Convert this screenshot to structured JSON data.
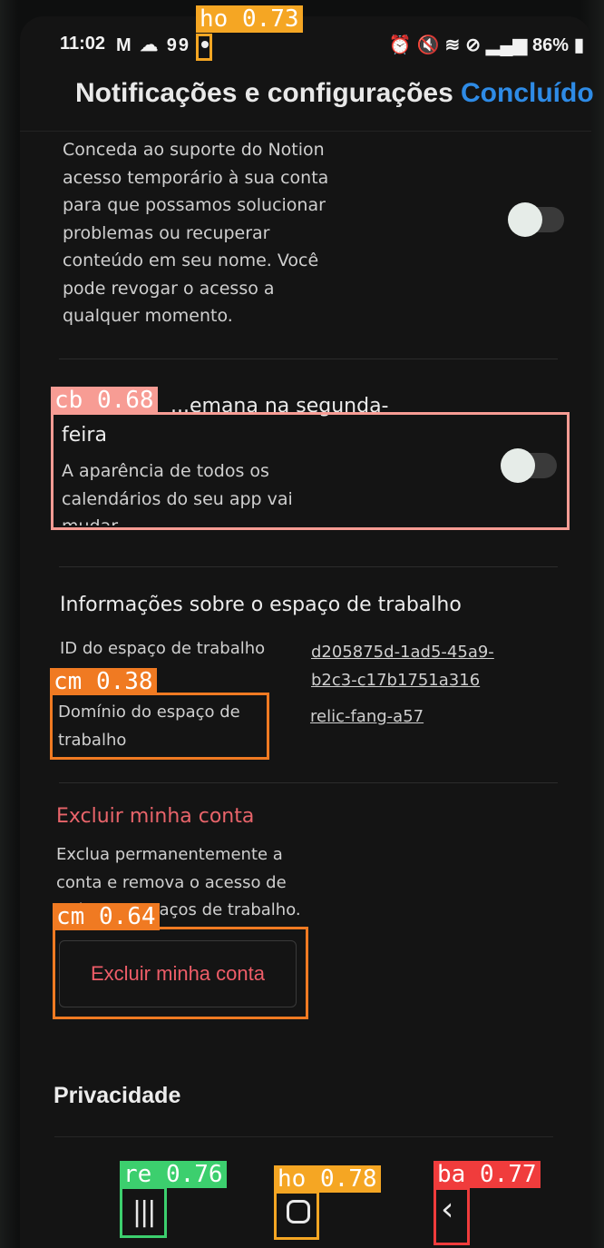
{
  "status_bar": {
    "time": "11:02",
    "left_icons": "M ☁ 99",
    "battery": "86%"
  },
  "header": {
    "title": "Notificações e configurações",
    "done_label": "Concluído"
  },
  "support_access": {
    "description_lines": [
      "Conceda ao suporte do Notion",
      "acesso temporário à sua conta",
      "para que possamos solucionar",
      "problemas ou recuperar",
      "conteúdo em seu nome. Você",
      "pode revogar o acesso a",
      "qualquer momento."
    ],
    "toggle_on": false
  },
  "week_start": {
    "title_line1": "...emana na segunda-",
    "title_line2": "feira",
    "description_lines": [
      "A aparência de todos os",
      "calendários do seu app vai",
      "mudar"
    ],
    "toggle_on": false
  },
  "workspace_info": {
    "title": "Informações sobre o espaço de trabalho",
    "id_label": "ID do espaço de trabalho",
    "id_value_line1": "d205875d-1ad5-45a9-",
    "id_value_line2": "b2c3-c17b1751a316",
    "domain_label_line1": "Domínio do espaço de",
    "domain_label_line2": "trabalho",
    "domain_value": "relic-fang-a57"
  },
  "delete_account": {
    "title": "Excluir minha conta",
    "description_lines": [
      "Exclua permanentemente a",
      "conta e remova o acesso de",
      "todos os espaços de trabalho."
    ],
    "button_label": "Excluir minha conta"
  },
  "privacy": {
    "title": "Privacidade"
  },
  "annotations": [
    {
      "label": "ho 0.73",
      "color": "#f5a623"
    },
    {
      "label": "cb 0.68",
      "color": "#f79c94"
    },
    {
      "label": "cm 0.38",
      "color": "#f07a22"
    },
    {
      "label": "cm 0.64",
      "color": "#f07a22"
    },
    {
      "label": "re 0.76",
      "color": "#3ccf6e"
    },
    {
      "label": "ho 0.78",
      "color": "#f5a623"
    },
    {
      "label": "ba 0.77",
      "color": "#f03c3c"
    }
  ],
  "icons": {
    "recents": "recent-apps-icon",
    "home": "home-icon",
    "back": "back-icon"
  }
}
